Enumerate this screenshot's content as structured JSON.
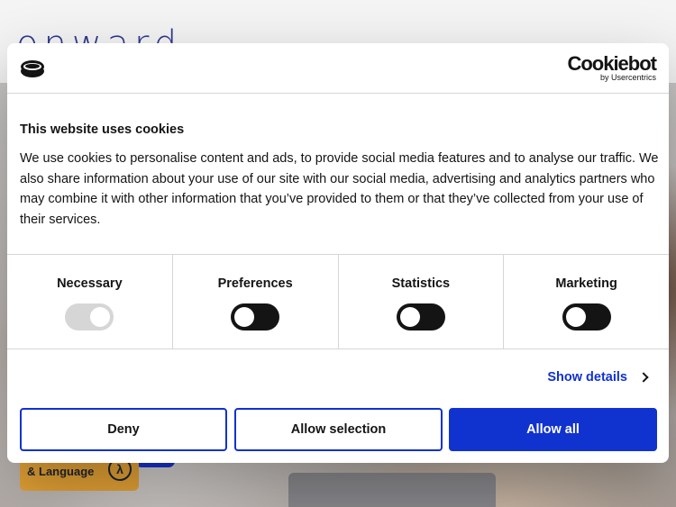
{
  "background": {
    "logo_text": "onward",
    "accessibility_label": "& Language"
  },
  "dialog": {
    "brand_name": "Cookiebot",
    "brand_sub": "by Usercentrics",
    "title": "This website uses cookies",
    "body": "We use cookies to personalise content and ads, to provide social media features and to analyse our traffic. We also share information about your use of our site with our social media, advertising and analytics partners who may combine it with other information that you’ve provided to them or that they’ve collected from your use of their services.",
    "categories": [
      {
        "label": "Necessary",
        "checked": true,
        "disabled": true
      },
      {
        "label": "Preferences",
        "checked": false,
        "disabled": false
      },
      {
        "label": "Statistics",
        "checked": false,
        "disabled": false
      },
      {
        "label": "Marketing",
        "checked": false,
        "disabled": false
      }
    ],
    "show_details_label": "Show details",
    "buttons": {
      "deny": "Deny",
      "allow_selection": "Allow selection",
      "allow_all": "Allow all"
    }
  },
  "colors": {
    "accent": "#1032cf",
    "toggle_off": "#141414",
    "toggle_disabled": "#d6d6d6",
    "accessibility_badge": "#e8a536"
  }
}
